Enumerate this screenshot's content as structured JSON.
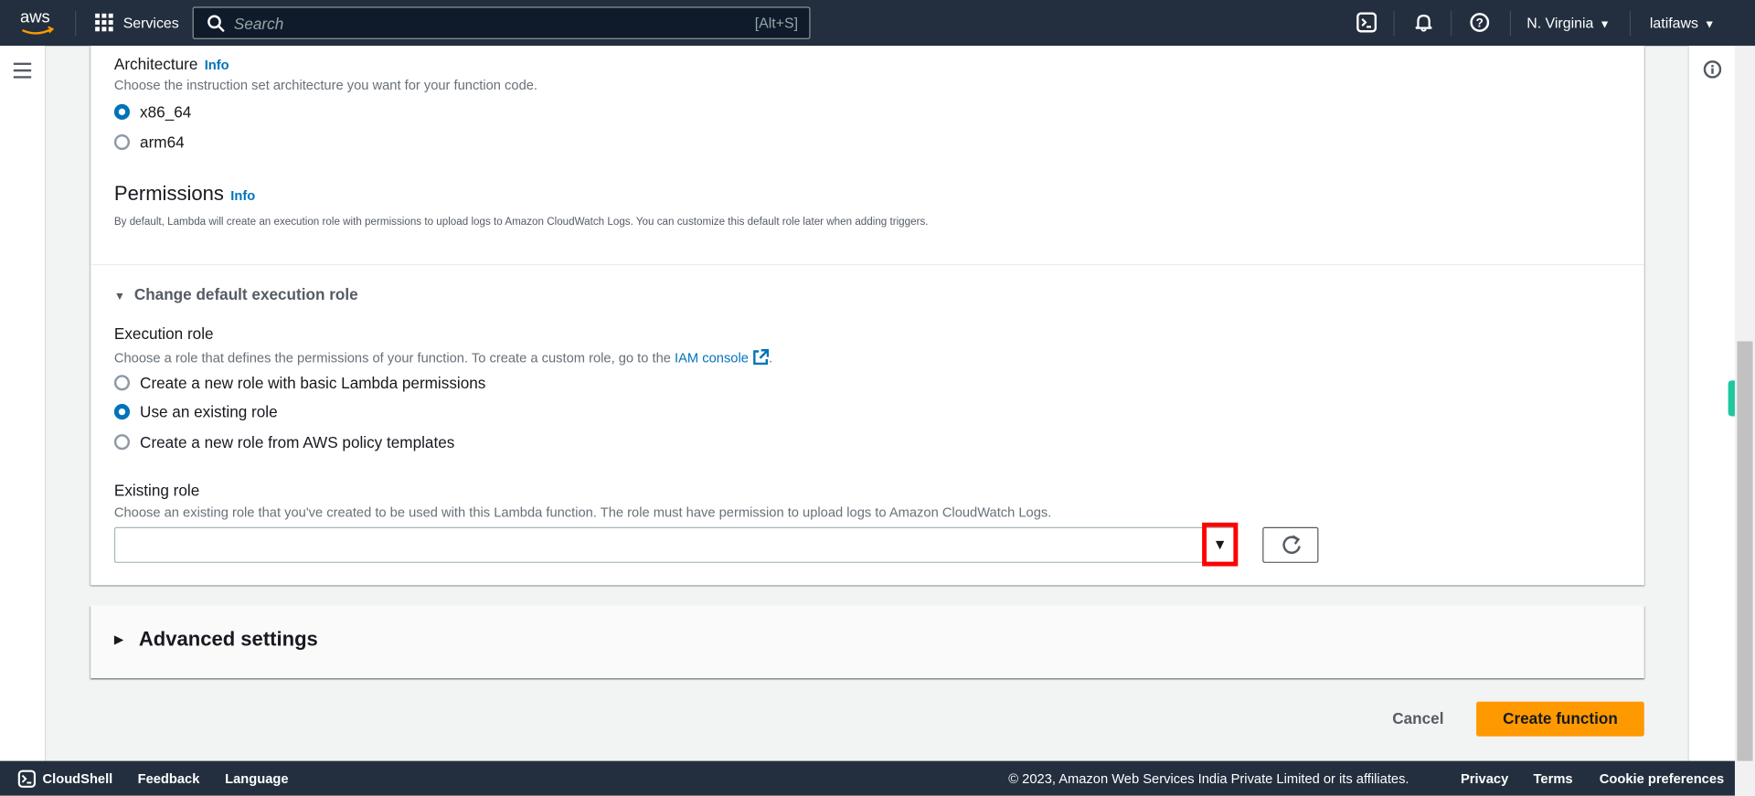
{
  "topbar": {
    "logo": "aws",
    "services": "Services",
    "search_placeholder": "Search",
    "search_shortcut": "[Alt+S]",
    "region": "N. Virginia",
    "user": "latifaws"
  },
  "architecture": {
    "label": "Architecture",
    "info": "Info",
    "description": "Choose the instruction set architecture you want for your function code.",
    "options": [
      {
        "label": "x86_64",
        "selected": true
      },
      {
        "label": "arm64",
        "selected": false
      }
    ]
  },
  "permissions": {
    "title": "Permissions",
    "info": "Info",
    "description": "By default, Lambda will create an execution role with permissions to upload logs to Amazon CloudWatch Logs. You can customize this default role later when adding triggers."
  },
  "execution_role_section": {
    "toggle": "Change default execution role",
    "label": "Execution role",
    "description": "Choose a role that defines the permissions of your function. To create a custom role, go to the",
    "link": "IAM console",
    "link_suffix": ".",
    "options": [
      {
        "label": "Create a new role with basic Lambda permissions",
        "selected": false
      },
      {
        "label": "Use an existing role",
        "selected": true
      },
      {
        "label": "Create a new role from AWS policy templates",
        "selected": false
      }
    ]
  },
  "existing_role": {
    "label": "Existing role",
    "description": "Choose an existing role that you've created to be used with this Lambda function. The role must have permission to upload logs to Amazon CloudWatch Logs.",
    "value": ""
  },
  "advanced": {
    "title": "Advanced settings"
  },
  "actions": {
    "cancel": "Cancel",
    "create": "Create function"
  },
  "footer": {
    "cloudshell": "CloudShell",
    "feedback": "Feedback",
    "language": "Language",
    "copyright": "© 2023, Amazon Web Services India Private Limited or its affiliates.",
    "privacy": "Privacy",
    "terms": "Terms",
    "cookies": "Cookie preferences"
  },
  "colors": {
    "nav": "#232f3e",
    "accent": "#0073bb",
    "primary_button": "#ff9900",
    "highlight": "#ff0000"
  }
}
